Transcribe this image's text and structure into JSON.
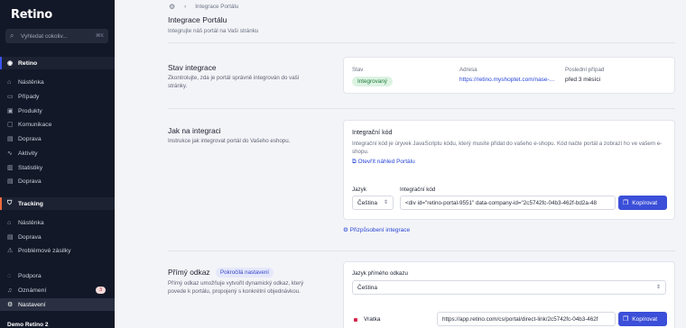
{
  "sidebar": {
    "logo": "Retino",
    "search_placeholder": "Vyhledat cokoliv...",
    "search_shortcut": "⌘K",
    "retino_label": "Retino",
    "retino_items": [
      "Nástěnka",
      "Případy",
      "Produkty",
      "Komunikace",
      "Doprava",
      "Aktivity",
      "Statistiky",
      "Doprava"
    ],
    "tracking_label": "Tracking",
    "tracking_items": [
      "Nástěnka",
      "Doprava",
      "Problémové zásilky"
    ],
    "bottom_items": [
      "Podpora",
      "Oznámení",
      "Nastavení"
    ],
    "notifications_count": "3",
    "footer": "Demo Retino 2"
  },
  "breadcrumb": {
    "current": "Integrace Portálu"
  },
  "page": {
    "title": "Integrace Portálu",
    "subtitle": "Integrujte náš portál na Vaši stránku"
  },
  "status_section": {
    "title": "Stav integrace",
    "description": "Zkontrolujte, zda je portál správně integrován do vaší stránky.",
    "status_label": "Stav",
    "status_value": "Integrovaný",
    "address_label": "Adresa",
    "address_value": "https://retino.myshoptet.com/nase-...",
    "last_case_label": "Poslední případ",
    "last_case_value": "před 3 měsíci"
  },
  "integration_section": {
    "title": "Jak na integraci",
    "description": "Instrukce jak integrovat portál do Vašeho eshopu.",
    "card_title": "Integrační kód",
    "card_text": "Integrační kód je úryvek JavaScriptu kódu, který musíte přidat do vašeho e-shopu. Kód načte portál a zobrazí ho ve vašem e-shopu.",
    "preview_link": "Otevřít náhled Portálu",
    "language_label": "Jazyk",
    "language_value": "Čeština",
    "code_label": "Integrační kód",
    "code_value": "<div id=\"retino-portal-9551\" data-company-id=\"2c5742fc-04b3-462f-bd2a-48",
    "copy_label": "Kopírovat",
    "customize_link": "Přizpůsobení integrace"
  },
  "direct_link_section": {
    "title": "Přímý odkaz",
    "tag": "Pokročilá nastavení",
    "description": "Přímý odkaz umožňuje vytvořit dynamický odkaz, který povede k portálu, propojený s konkrétní objednávkou.",
    "language_label": "Jazyk přímého odkazu",
    "language_value": "Čeština",
    "row_label": "Vratka",
    "row_url": "https://app.retino.com/cs/portal/direct-link/2c5742fc-04b3-462f",
    "copy_label": "Kopírovat"
  },
  "colors": {
    "accent": "#3b4fd8",
    "sidebar_bg": "#131828",
    "success": "#227a3d",
    "tracking": "#ef6b3c"
  }
}
